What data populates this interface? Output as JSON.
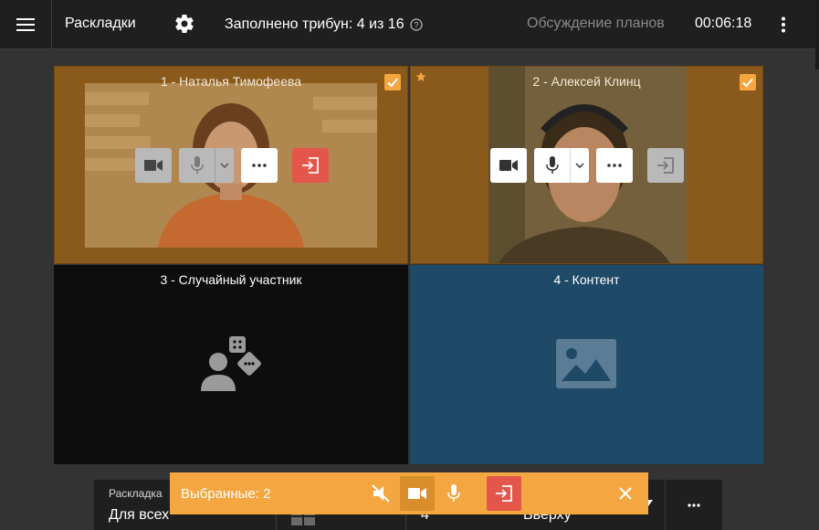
{
  "header": {
    "title": "Раскладки",
    "filled": "Заполнено трибун: 4 из 16",
    "meeting_name": "Обсуждение планов",
    "timer": "00:06:18"
  },
  "tiles": [
    {
      "label": "1 - Наталья Тимофеева",
      "selected": true
    },
    {
      "label": "2 - Алексей Клинц",
      "selected": true,
      "starred": true
    },
    {
      "label": "3 - Случайный участник"
    },
    {
      "label": "4 - Контент"
    }
  ],
  "selection_bar": {
    "label": "Выбранные: 2"
  },
  "bottom_bar": {
    "layout_label": "Раскладка",
    "layout_value": "Для всех",
    "count_value": "4",
    "position_value": "Вверху"
  },
  "colors": {
    "accent": "#f4a640",
    "danger": "#e4564a",
    "content_tile": "#1e4a68",
    "header": "#1f1f1f",
    "background": "#333333"
  },
  "icons": [
    "menu-icon",
    "gear-icon",
    "help-icon",
    "more-vert-icon",
    "camera-icon",
    "mic-icon",
    "chevron-down-icon",
    "more-horiz-icon",
    "exit-icon",
    "check-icon",
    "star-icon",
    "random-user-icon",
    "image-icon",
    "mute-all-icon",
    "close-icon",
    "layout-grid-icon"
  ]
}
